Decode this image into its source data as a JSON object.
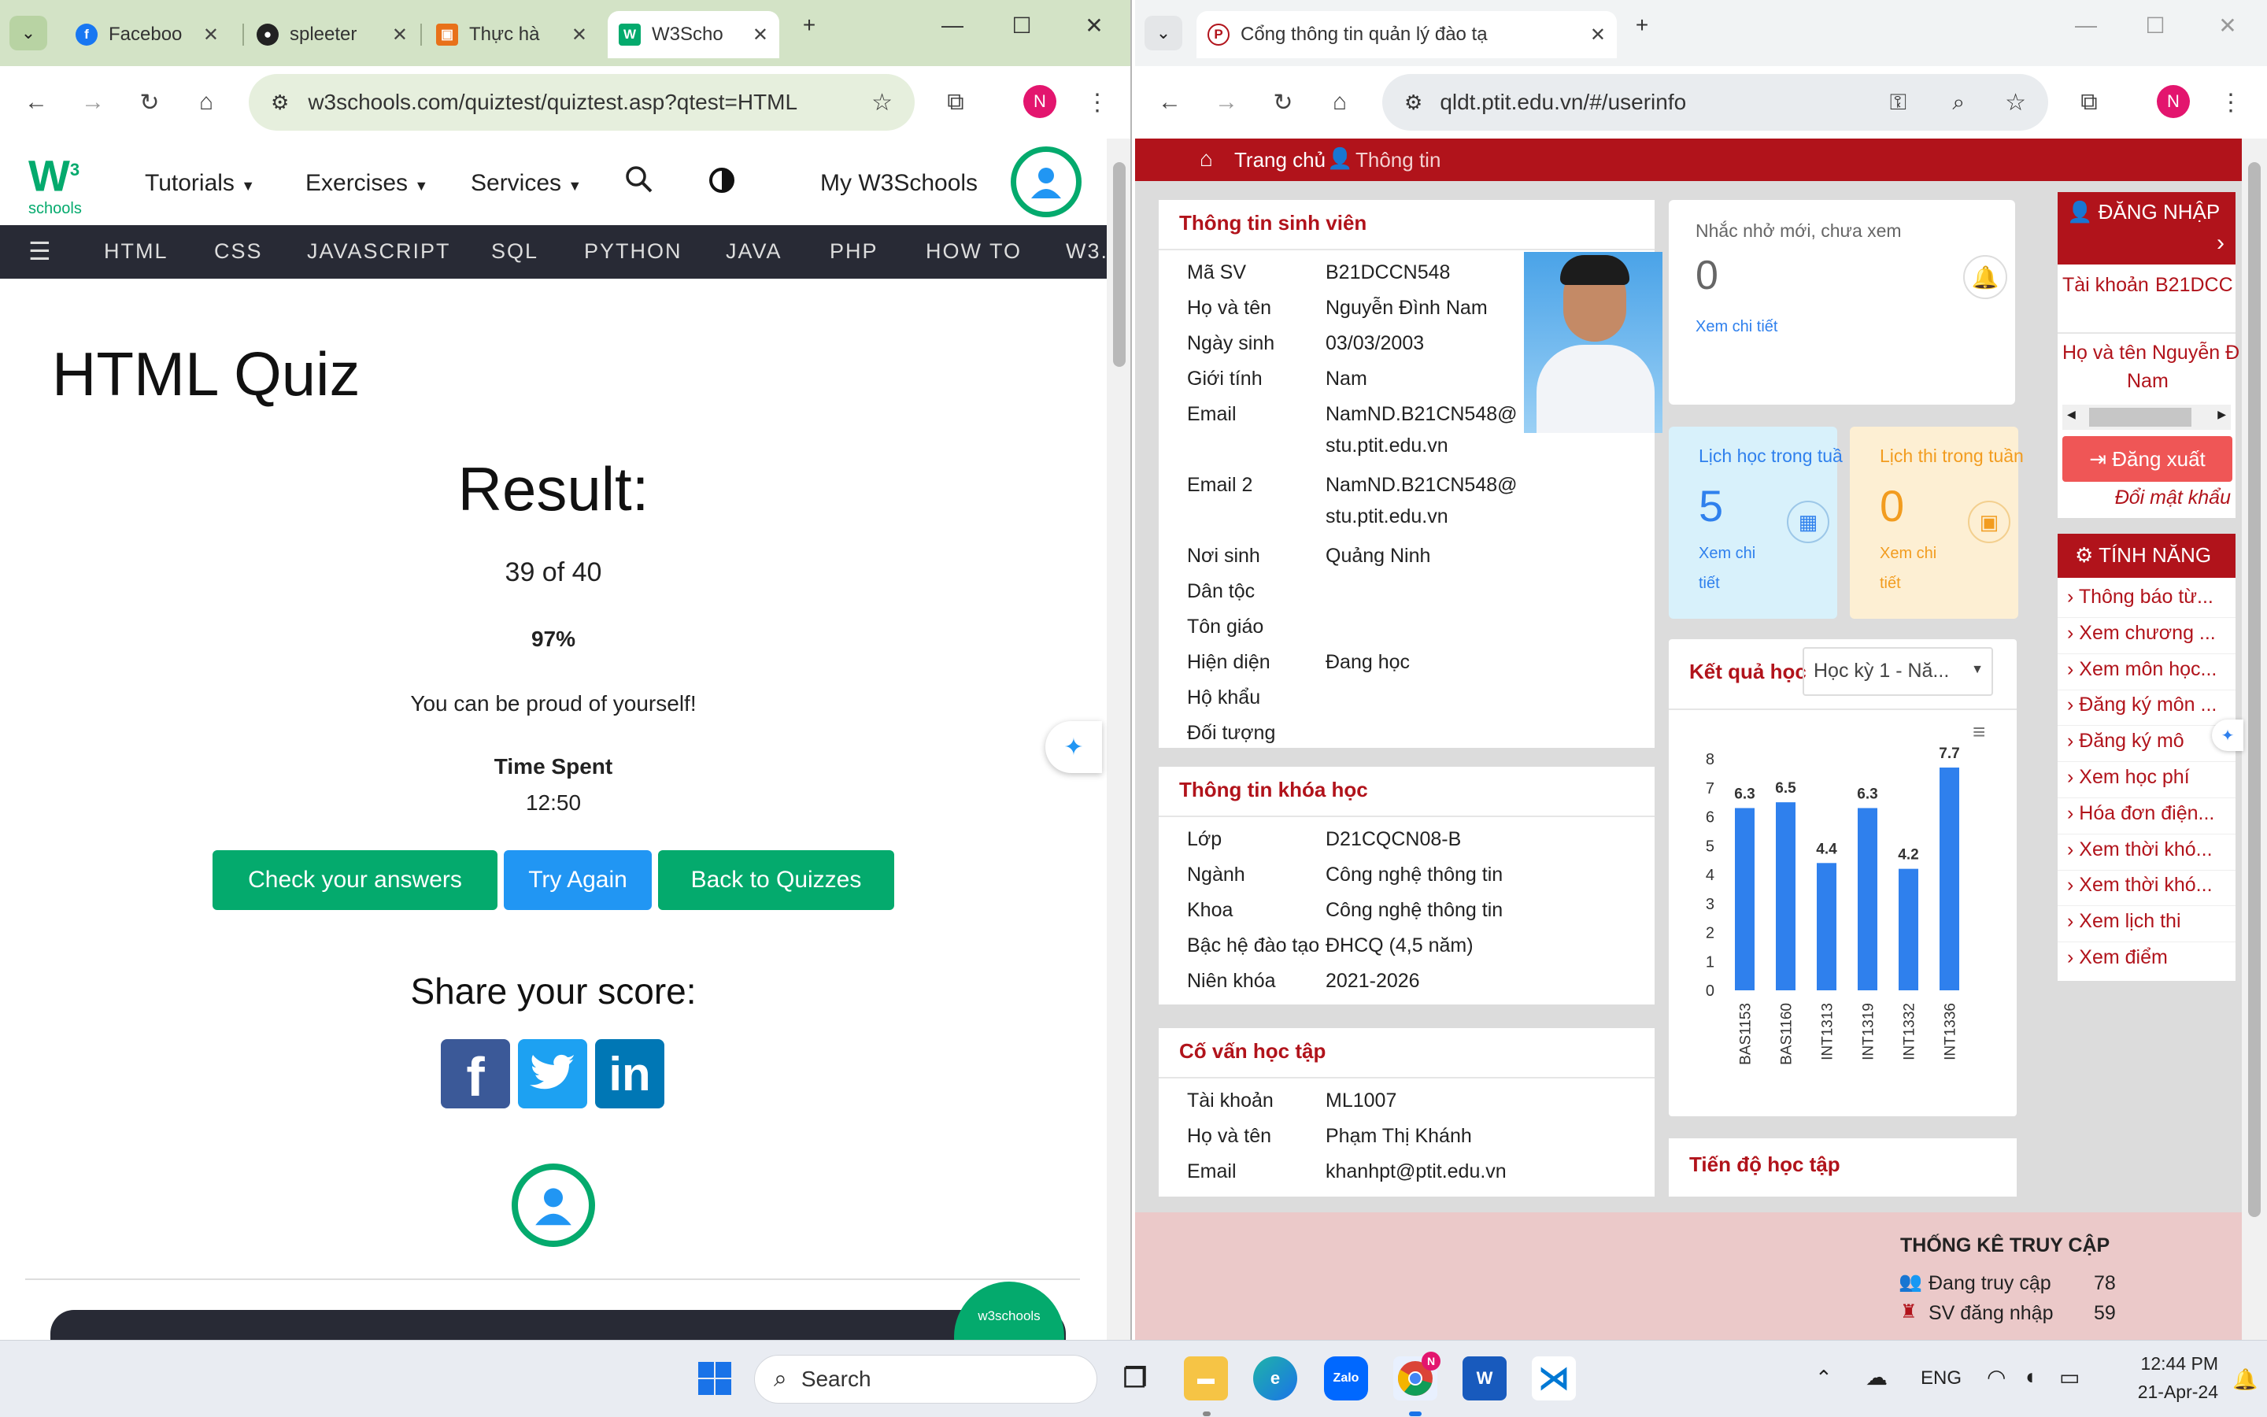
{
  "left_browser": {
    "tabs": [
      {
        "label": "Faceboo",
        "icon": "facebook-icon"
      },
      {
        "label": "spleeter",
        "icon": "github-icon"
      },
      {
        "label": "Thực hà",
        "icon": "slides-icon"
      },
      {
        "label": "W3Scho",
        "icon": "w3schools-icon",
        "active": true
      }
    ],
    "url": "w3schools.com/quiztest/quiztest.asp?qtest=HTML",
    "profile_initial": "N"
  },
  "w3": {
    "logo_text": "schools",
    "logo_sup": "3",
    "menu": {
      "tutorials": "Tutorials",
      "exercises": "Exercises",
      "services": "Services",
      "my": "My W3Schools"
    },
    "nav": [
      "HTML",
      "CSS",
      "JAVASCRIPT",
      "SQL",
      "PYTHON",
      "JAVA",
      "PHP",
      "HOW TO",
      "W3."
    ],
    "heading": "HTML Quiz",
    "result_title": "Result:",
    "score": "39 of 40",
    "percent": "97%",
    "message": "You can be proud of yourself!",
    "time_label": "Time Spent",
    "time_value": "12:50",
    "buttons": {
      "check": "Check your answers",
      "again": "Try Again",
      "back": "Back to Quizzes"
    },
    "share_title": "Share your score:",
    "badge_text": "w3schools"
  },
  "right_browser": {
    "tab_label": "Cổng thông tin quản lý đào tạ",
    "url": "qldt.ptit.edu.vn/#/userinfo",
    "profile_initial": "N"
  },
  "ptit": {
    "nav": {
      "home": "Trang chủ",
      "info": "Thông tin"
    },
    "student": {
      "title": "Thông tin sinh viên",
      "rows": [
        {
          "label": "Mã SV",
          "value": "B21DCCN548"
        },
        {
          "label": "Họ và tên",
          "value": "Nguyễn Đình Nam"
        },
        {
          "label": "Ngày sinh",
          "value": "03/03/2003"
        },
        {
          "label": "Giới tính",
          "value": "Nam"
        },
        {
          "label": "Email",
          "value": "NamND.B21CN548@",
          "value2": "stu.ptit.edu.vn"
        },
        {
          "label": "Email 2",
          "value": "NamND.B21CN548@",
          "value2": "stu.ptit.edu.vn"
        },
        {
          "label": "Nơi sinh",
          "value": "Quảng Ninh"
        },
        {
          "label": "Dân tộc",
          "value": ""
        },
        {
          "label": "Tôn giáo",
          "value": ""
        },
        {
          "label": "Hiện diện",
          "value": "Đang học"
        },
        {
          "label": "Hộ khẩu",
          "value": ""
        },
        {
          "label": "Đối tượng",
          "value": ""
        }
      ]
    },
    "course": {
      "title": "Thông tin khóa học",
      "rows": [
        {
          "label": "Lớp",
          "value": "D21CQCN08-B"
        },
        {
          "label": "Ngành",
          "value": "Công nghệ thông tin"
        },
        {
          "label": "Khoa",
          "value": "Công nghệ thông tin"
        },
        {
          "label": "Bậc hệ đào tạo",
          "value": "ĐHCQ (4,5 năm)"
        },
        {
          "label": "Niên khóa",
          "value": "2021-2026"
        }
      ]
    },
    "advisor": {
      "title": "Cố vấn học tập",
      "rows": [
        {
          "label": "Tài khoản",
          "value": "ML1007"
        },
        {
          "label": "Họ và tên",
          "value": "Phạm Thị Khánh"
        },
        {
          "label": "Email",
          "value": "khanhpt@ptit.edu.vn"
        }
      ]
    },
    "reminder": {
      "title": "Nhắc nhở mới, chưa xem",
      "count": "0",
      "link": "Xem chi tiết"
    },
    "week_schedule": {
      "title": "Lịch học trong tuầ",
      "count": "5",
      "link1": "Xem chi",
      "link2": "tiết"
    },
    "exam_schedule": {
      "title": "Lịch thi trong tuần",
      "count": "0",
      "link1": "Xem chi",
      "link2": "tiết"
    },
    "results": {
      "title": "Kết quả học",
      "select": "Học kỳ 1 - Nă..."
    },
    "progress_title": "Tiến độ học tập",
    "login": {
      "title": "ĐĂNG NHẬP",
      "account_label": "Tài khoản",
      "account_value": "B21DCC",
      "name_label": "Họ và tên",
      "name_value": "Nguyễn Đ",
      "name_value2": "Nam",
      "logout": "Đăng xuất",
      "change_pw": "Đổi mật khẩu"
    },
    "features": {
      "title": "TÍNH NĂNG",
      "items": [
        "Thông báo từ...",
        "Xem chương ...",
        "Xem môn học...",
        "Đăng ký môn ...",
        "Đăng ký mô",
        "Xem học phí",
        "Hóa đơn điện...",
        "Xem thời khó...",
        "Xem thời khó...",
        "Xem lịch thi",
        "Xem điểm"
      ]
    },
    "stats": {
      "title": "THỐNG KÊ TRUY CẬP",
      "rows": [
        {
          "label": "Đang truy cập",
          "value": "78"
        },
        {
          "label": "SV đăng nhập",
          "value": "59"
        }
      ]
    }
  },
  "chart_data": {
    "type": "bar",
    "categories": [
      "BAS1153",
      "BAS1160",
      "INT1313",
      "INT1319",
      "INT1332",
      "INT1336"
    ],
    "values": [
      6.3,
      6.5,
      4.4,
      6.3,
      4.2,
      7.7
    ],
    "ylim": [
      0,
      8
    ],
    "yticks": [
      0,
      1,
      2,
      3,
      4,
      5,
      6,
      7,
      8
    ],
    "color": "#2f80ed",
    "grid": false
  },
  "taskbar": {
    "search": "Search",
    "lang": "ENG",
    "time": "12:44 PM",
    "date": "21-Apr-24",
    "apps": [
      "windows-start-icon",
      "task-view-icon",
      "file-explorer-icon",
      "edge-icon",
      "zalo-icon",
      "chrome-icon",
      "word-icon",
      "vscode-icon"
    ],
    "zalo_label": "Zalo",
    "chrome_badge": "N",
    "word_label": "W"
  },
  "colors": {
    "w3green": "#04aa6d",
    "w3blue": "#2196f3",
    "ptitRed": "#b1131b",
    "w3dark": "#282a35"
  }
}
